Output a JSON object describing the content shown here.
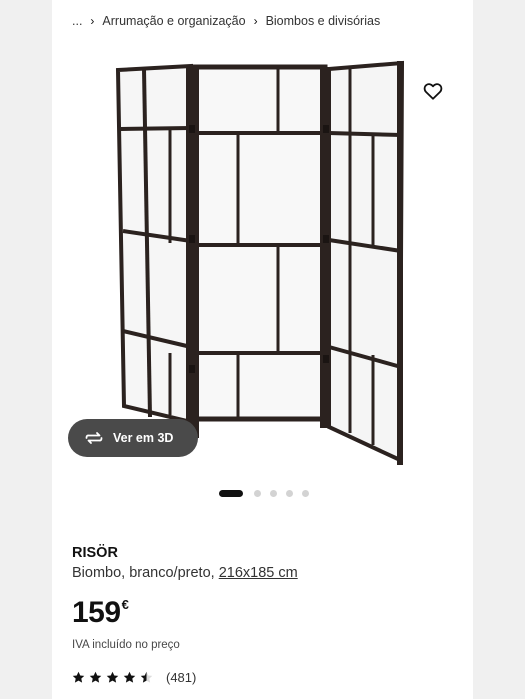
{
  "breadcrumb": {
    "ellipsis": "...",
    "items": [
      {
        "label": "Arrumação e organização"
      },
      {
        "label": "Biombos e divisórias"
      }
    ]
  },
  "gallery": {
    "view_3d_label": "Ver em 3D",
    "dots_total": 5,
    "active_dot": 1
  },
  "product": {
    "name": "RISÖR",
    "description": "Biombo, branco/preto,",
    "measurements": "216x185 cm",
    "price": "159",
    "currency": "€",
    "vat_note": "IVA incluído no preço",
    "rating": {
      "value": 4.5,
      "max": 5,
      "review_count": "(481)"
    }
  },
  "icons": {
    "favorite": "heart-icon",
    "view_3d": "rotate-3d-icon",
    "breadcrumb_separator": "chevron-right-icon",
    "star": "star-icon"
  },
  "colors": {
    "text": "#111111",
    "pill_background": "#4a4a4a",
    "dot_active": "#111111",
    "dot_inactive": "#d3d3d3",
    "frame": "#2b221f"
  }
}
